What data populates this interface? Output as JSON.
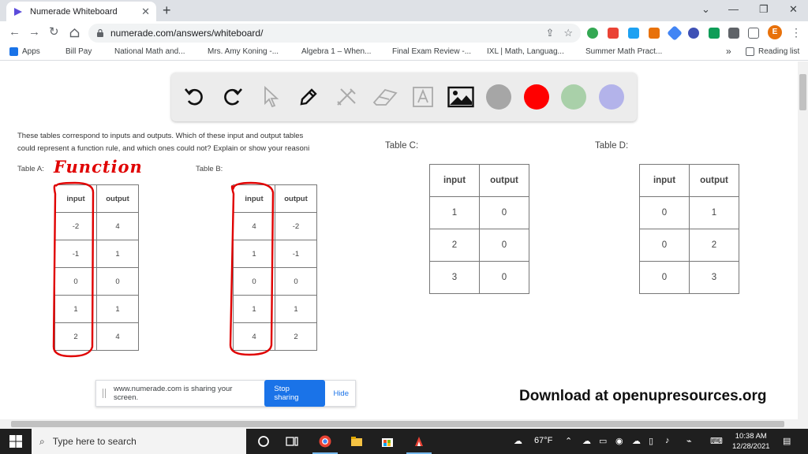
{
  "browser": {
    "tab_title": "Numerade Whiteboard",
    "tab_close": "✕",
    "new_tab": "+",
    "window_controls": {
      "minimize": "⌄",
      "restore": "—",
      "maximize": "❐",
      "close": "✕"
    },
    "url": "numerade.com/answers/whiteboard/",
    "profile_initial": "E",
    "bookmarks": [
      {
        "label": "Apps",
        "color": "#1a73e8"
      },
      {
        "label": "Bill Pay",
        "color": "#ffffff"
      },
      {
        "label": "National Math and...",
        "color": "#c0392b"
      },
      {
        "label": "Mrs. Amy Koning -...",
        "color": "#4a6fa5"
      },
      {
        "label": "Algebra 1 – When...",
        "color": "#7b3fa0"
      },
      {
        "label": "Final Exam Review -...",
        "color": "#1a73e8"
      },
      {
        "label": "IXL | Math, Languag...",
        "color": "#b7c700"
      },
      {
        "label": "Summer Math Pract...",
        "color": "#6d3b2a"
      }
    ],
    "bookmarks_more": "»",
    "reading_list": "Reading list"
  },
  "drawing_toolbar": {
    "colors": [
      "#a6a6a6",
      "#ff0000",
      "#a9d0a9",
      "#b3b3ea"
    ]
  },
  "worksheet": {
    "prompt_line1": "These tables correspond to inputs and outputs. Which of these input and output tables",
    "prompt_line2": "could represent a function rule, and which ones could not? Explain or show your reasoni",
    "table_a": {
      "label": "Table A:",
      "headers": [
        "input",
        "output"
      ],
      "rows": [
        [
          "-2",
          "4"
        ],
        [
          "-1",
          "1"
        ],
        [
          "0",
          "0"
        ],
        [
          "1",
          "1"
        ],
        [
          "2",
          "4"
        ]
      ]
    },
    "table_b": {
      "label": "Table B:",
      "headers": [
        "input",
        "output"
      ],
      "rows": [
        [
          "4",
          "-2"
        ],
        [
          "1",
          "-1"
        ],
        [
          "0",
          "0"
        ],
        [
          "1",
          "1"
        ],
        [
          "4",
          "2"
        ]
      ]
    },
    "table_c": {
      "label": "Table C:",
      "headers": [
        "input",
        "output"
      ],
      "rows": [
        [
          "1",
          "0"
        ],
        [
          "2",
          "0"
        ],
        [
          "3",
          "0"
        ]
      ]
    },
    "table_d": {
      "label": "Table D:",
      "headers": [
        "input",
        "output"
      ],
      "rows": [
        [
          "0",
          "1"
        ],
        [
          "0",
          "2"
        ],
        [
          "0",
          "3"
        ]
      ]
    },
    "handwritten_note": "Function",
    "annotation_color": "#e00000",
    "download_text": "Download at openupresources.org"
  },
  "share_bar": {
    "message": "www.numerade.com is sharing your screen.",
    "stop_label": "Stop sharing",
    "hide_label": "Hide"
  },
  "taskbar": {
    "search_placeholder": "Type here to search",
    "weather": "67°F",
    "time": "10:38 AM",
    "date": "12/28/2021"
  }
}
